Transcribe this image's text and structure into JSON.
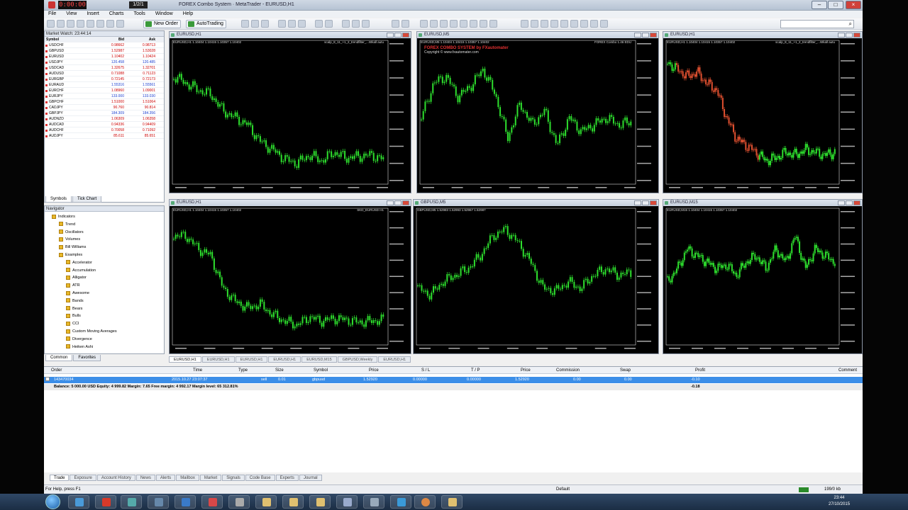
{
  "window": {
    "title": "FOREX Combo System · MetaTrader - EURUSD,H1",
    "time_display": "0:00:00",
    "counter": "1/2/1"
  },
  "menu": [
    "File",
    "View",
    "Insert",
    "Charts",
    "Tools",
    "Window",
    "Help"
  ],
  "toolbar": {
    "new_order": "New Order",
    "auto_trading": "AutoTrading"
  },
  "market_watch": {
    "title": "Market Watch: 23:44:14",
    "headers": {
      "symbol": "Symbol",
      "bid": "Bid",
      "ask": "Ask"
    },
    "rows": [
      {
        "symbol": "USDCHF",
        "bid": "0.98662",
        "ask": "0.98713",
        "up": false
      },
      {
        "symbol": "GBPUSD",
        "bid": "1.52987",
        "ask": "1.53028",
        "up": false
      },
      {
        "symbol": "EURUSD",
        "bid": "1.10402",
        "ask": "1.10424",
        "up": false
      },
      {
        "symbol": "USDJPY",
        "bid": "120.458",
        "ask": "120.485",
        "up": true
      },
      {
        "symbol": "USDCAD",
        "bid": "1.32675",
        "ask": "1.32701",
        "up": false
      },
      {
        "symbol": "AUDUSD",
        "bid": "0.71088",
        "ask": "0.71123",
        "up": false
      },
      {
        "symbol": "EURGBP",
        "bid": "0.72145",
        "ask": "0.72173",
        "up": false
      },
      {
        "symbol": "EURAUD",
        "bid": "1.55316",
        "ask": "1.55561",
        "up": true
      },
      {
        "symbol": "EURCHF",
        "bid": "1.08960",
        "ask": "1.09001",
        "up": false
      },
      {
        "symbol": "EURJPY",
        "bid": "133.000",
        "ask": "133.030",
        "up": true
      },
      {
        "symbol": "GBPCHF",
        "bid": "1.51000",
        "ask": "1.51064",
        "up": false
      },
      {
        "symbol": "CADJPY",
        "bid": "90.760",
        "ask": "90.814",
        "up": false
      },
      {
        "symbol": "GBPJPY",
        "bid": "184.309",
        "ask": "184.356",
        "up": true
      },
      {
        "symbol": "AUDNZD",
        "bid": "1.06309",
        "ask": "1.06358",
        "up": false
      },
      {
        "symbol": "AUDCAD",
        "bid": "0.94336",
        "ask": "0.94409",
        "up": false
      },
      {
        "symbol": "AUDCHF",
        "bid": "0.70058",
        "ask": "0.71092",
        "up": false
      },
      {
        "symbol": "AUDJPY",
        "bid": "85.611",
        "ask": "85.651",
        "up": false
      }
    ],
    "tabs": [
      "Symbols",
      "Tick Chart"
    ]
  },
  "navigator": {
    "title": "Navigator",
    "items": [
      "Indicators",
      "Trend",
      "Oscillators",
      "Volumes",
      "Bill Williams",
      "Examples",
      "Accelerator",
      "Accumulation",
      "Alligator",
      "ATR",
      "Awesome",
      "Bands",
      "Bears",
      "Bulls",
      "CCI",
      "Custom Moving Averages",
      "Divergence",
      "Heiken Ashi"
    ],
    "tabs": [
      "Common",
      "Favorites"
    ]
  },
  "charts": [
    {
      "title": "EURUSD,H1",
      "info": "EURUSD,H1  1.10404 1.10415 1.10357 1.10402",
      "label": "scalp_8_11_+1_2_trendfilter_...Wkall autu",
      "color": "#2ee02e"
    },
    {
      "title": "EURUSD,M5",
      "info": "EURUSD,M5  1.10404 1.10415 1.10357 1.10402",
      "label": "FOREX Combo 1.46 EDU",
      "overlay": {
        "title": "FOREX COMBO SYSTEM by FXautomater",
        "copy": "Copyright © www.fxautomater.com"
      },
      "color": "#2ee02e"
    },
    {
      "title": "EURUSD,H1",
      "info": "EURUSD,H1  1.10404 1.10415 1.10357 1.10402",
      "label": "scalp_8_11_+1_2_trendfilter_...Wkall autu",
      "color": "#2ee02e"
    },
    {
      "title": "EURUSD,H1",
      "info": "EURUSD,H1  1.10404 1.10415 1.10357 1.10402",
      "label": "SKD_EURUSD H1",
      "color": "#2ee02e"
    },
    {
      "title": "GBPUSD,M5",
      "info": "GBPUSD,M5  1.52983 1.52993 1.52967 1.52987",
      "label": "",
      "color": "#2ee02e"
    },
    {
      "title": "EURUSD,M15",
      "info": "EURUSD,M15  1.10404 1.10415 1.10357 1.10402",
      "label": "",
      "color": "#2ee02e"
    }
  ],
  "chart_tabs": [
    "EURUSD,H1",
    "EURUSD,H1",
    "EURUSD,H1",
    "EURUSD,H1",
    "EURUSD,M15",
    "GBPUSD,Weekly",
    "EURUSD,H1"
  ],
  "terminal": {
    "headers": [
      "Order",
      "Time",
      "Type",
      "Size",
      "Symbol",
      "Price",
      "S / L",
      "T / P",
      "Price",
      "Commission",
      "Swap",
      "Profit",
      "Comment"
    ],
    "order": {
      "order": "143470034",
      "time": "2015.10.27 23:07:37",
      "type": "sell",
      "size": "0.01",
      "symbol": "gbpusd",
      "price": "1.52920",
      "sl": "0.00000",
      "tp": "0.00000",
      "price2": "1.52920",
      "commission": "0.00",
      "swap": "0.00",
      "profit": "-0.10"
    },
    "balance": "Balance: 5 000.00 USD  Equity: 4 999.82  Margin: 7.65  Free margin: 4 992.17  Margin level: 65 312.81%",
    "balance_profit": "-0.18",
    "tabs": [
      "Trade",
      "Exposure",
      "Account History",
      "News",
      "Alerts",
      "Mailbox",
      "Market",
      "Signals",
      "Code Base",
      "Experts",
      "Journal"
    ]
  },
  "status": {
    "help": "For Help, press F1",
    "profile": "Default",
    "connection": "199/0 kb"
  },
  "clock": {
    "time": "23:44",
    "date": "27/10/2015"
  }
}
